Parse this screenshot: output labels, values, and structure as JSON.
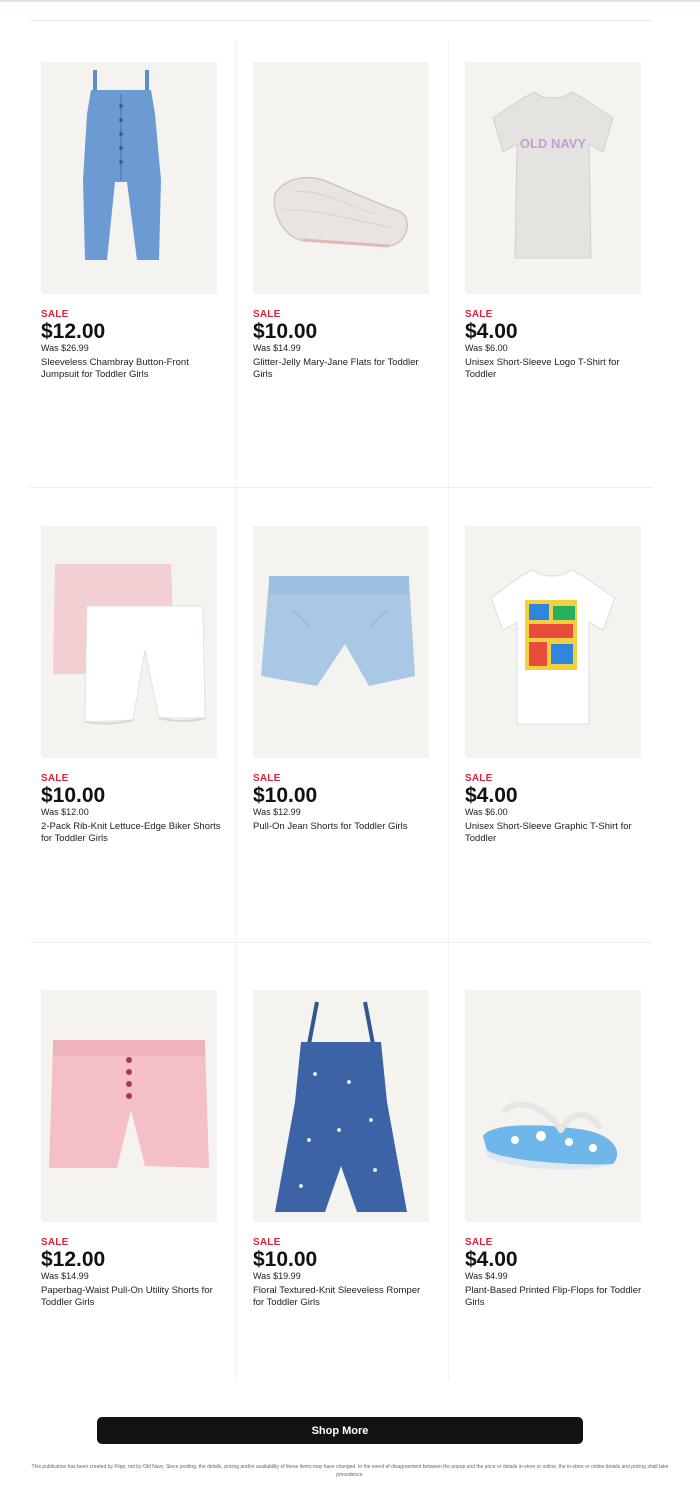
{
  "products": [
    {
      "sale": "SALE",
      "price": "$12.00",
      "was": "Was $26.99",
      "title": "Sleeveless Chambray Button-Front Jumpsuit for Toddler Girls",
      "image": "jumpsuit-image"
    },
    {
      "sale": "SALE",
      "price": "$10.00",
      "was": "Was $14.99",
      "title": "Glitter-Jelly Mary-Jane Flats for Toddler Girls",
      "image": "jelly-shoe-image"
    },
    {
      "sale": "SALE",
      "price": "$4.00",
      "was": "Was $6.00",
      "title": "Unisex Short-Sleeve Logo T-Shirt for Toddler",
      "image": "logo-tshirt-image",
      "logo_text": "OLD NAVY"
    },
    {
      "sale": "SALE",
      "price": "$10.00",
      "was": "Was $12.00",
      "title": "2-Pack Rib-Knit Lettuce-Edge Biker Shorts for Toddler Girls",
      "image": "biker-shorts-image"
    },
    {
      "sale": "SALE",
      "price": "$10.00",
      "was": "Was $12.99",
      "title": "Pull-On Jean Shorts for Toddler Girls",
      "image": "jean-shorts-image"
    },
    {
      "sale": "SALE",
      "price": "$4.00",
      "was": "Was $6.00",
      "title": "Unisex Short-Sleeve Graphic T-Shirt for Toddler",
      "image": "graphic-tshirt-image"
    },
    {
      "sale": "SALE",
      "price": "$12.00",
      "was": "Was $14.99",
      "title": "Paperbag-Waist Pull-On Utility Shorts for Toddler Girls",
      "image": "paperbag-shorts-image"
    },
    {
      "sale": "SALE",
      "price": "$10.00",
      "was": "Was $19.99",
      "title": "Floral Textured-Knit Sleeveless Romper for Toddler Girls",
      "image": "romper-image"
    },
    {
      "sale": "SALE",
      "price": "$4.00",
      "was": "Was $4.99",
      "title": "Plant-Based Printed Flip-Flops for Toddler Girls",
      "image": "flip-flops-image"
    }
  ],
  "shop_more_label": "Shop More",
  "disclaimer": "This publication has been created by Flipp, not by Old Navy. Since posting, the details, pricing and/or availability of these items may have changed. In the event of disagreement between the popup and the price or details in-store or online, the in-store or online details and pricing shall take precedence.",
  "colors": {
    "sale_red": "#d3263a",
    "button_bg": "#121212",
    "image_bg": "#f5f3ef"
  }
}
